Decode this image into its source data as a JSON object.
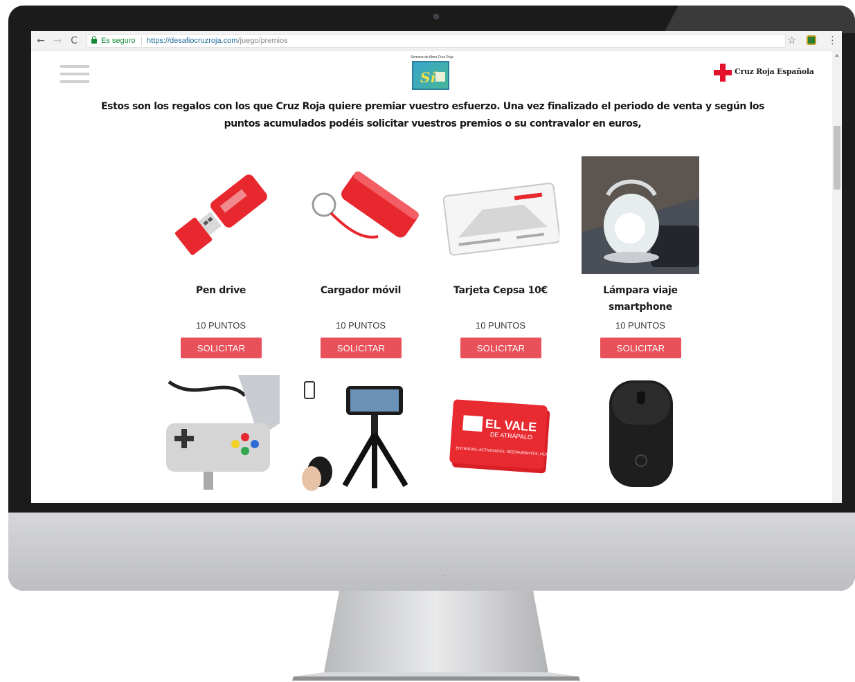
{
  "browser": {
    "secure_label": "Es seguro",
    "url_host": "https://desafiocruzroja.com",
    "url_path": "/juego/premios",
    "back_icon": "←",
    "forward_icon": "→",
    "reload_icon": "C",
    "star_icon": "☆",
    "menu_icon": "⋮"
  },
  "header": {
    "event_logo_topline": "Semana de Alma Cruz Roja",
    "event_logo_mark": "Sí",
    "brand_name": "Cruz Roja Española"
  },
  "intro_text": "Estos son los regalos con los que Cruz Roja quiere premiar vuestro esfuerzo. Una vez finalizado el periodo de venta y según los puntos acumulados podéis solicitar vuestros premios o su contravalor en euros,",
  "products": [
    {
      "name": "Pen drive",
      "points": "10 PUNTOS",
      "button": "SOLICITAR",
      "icon": "usb-drive-icon"
    },
    {
      "name": "Cargador móvil",
      "points": "10 PUNTOS",
      "button": "SOLICITAR",
      "icon": "power-bank-icon"
    },
    {
      "name": "Tarjeta Cepsa 10€",
      "points": "10 PUNTOS",
      "button": "SOLICITAR",
      "icon": "gift-card-icon"
    },
    {
      "name": "Lámpara viaje smartphone",
      "points": "10 PUNTOS",
      "button": "SOLICITAR",
      "icon": "lantern-icon"
    }
  ],
  "products_row2": [
    {
      "icon": "usb-hub-gamepad-icon"
    },
    {
      "icon": "phone-tripod-icon"
    },
    {
      "icon": "vale-atrapalo-icon",
      "title": "EL VALE",
      "subtitle": "DE ATRÁPALO",
      "caption": "ENTRADAS, ACTIVIDADES, RESTAURANTES, HOTELES, VIAJES, VUELOS, CRUCEROS"
    },
    {
      "icon": "wireless-mouse-icon"
    }
  ],
  "colors": {
    "accent": "#e8505a",
    "cross_red": "#e1122a",
    "secure_green": "#138a36"
  }
}
